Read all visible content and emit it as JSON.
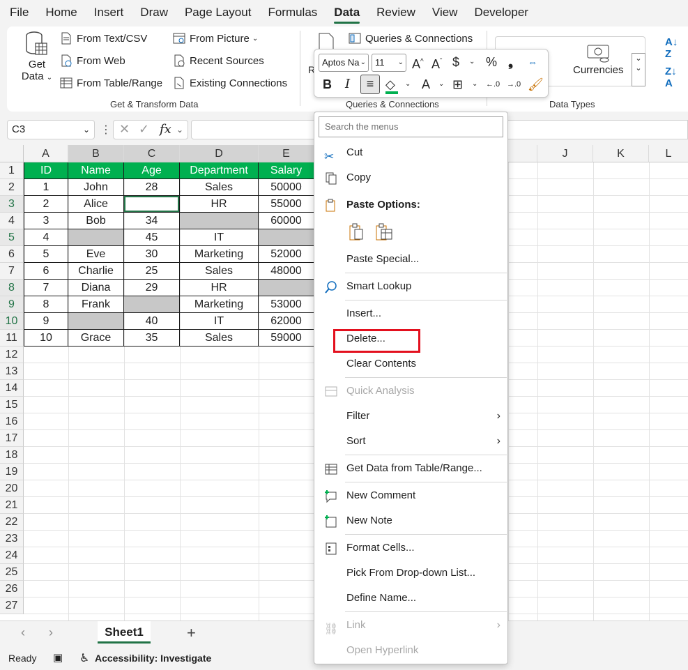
{
  "tabs": [
    "File",
    "Home",
    "Insert",
    "Draw",
    "Page Layout",
    "Formulas",
    "Data",
    "Review",
    "View",
    "Developer"
  ],
  "active_tab": "Data",
  "ribbon": {
    "get_data_label": "Get",
    "get_data_label2": "Data",
    "from_text_csv": "From Text/CSV",
    "from_web": "From Web",
    "from_table_range": "From Table/Range",
    "from_picture": "From Picture",
    "recent_sources": "Recent Sources",
    "existing_connections": "Existing Connections",
    "group_get_transform": "Get & Transform Data",
    "queries_connections": "Queries & Connections",
    "group_queries": "Queries & Connections",
    "refresh_partial": "R",
    "currencies": "Currencies",
    "group_data_types": "Data Types"
  },
  "mini_toolbar": {
    "font_name": "Aptos Na",
    "font_size": "11"
  },
  "formula_bar": {
    "name_box": "C3",
    "fx": "fx",
    "formula": ""
  },
  "columns": [
    "A",
    "B",
    "C",
    "D",
    "E",
    "J",
    "K",
    "L"
  ],
  "rows": [
    "1",
    "2",
    "3",
    "4",
    "5",
    "6",
    "7",
    "8",
    "9",
    "10",
    "11",
    "12",
    "13",
    "14",
    "15",
    "16",
    "17",
    "18",
    "19",
    "20",
    "21",
    "22",
    "23",
    "24",
    "25",
    "26",
    "27"
  ],
  "table": {
    "headers": [
      "ID",
      "Name",
      "Age",
      "Department",
      "Salary"
    ],
    "data": [
      [
        "1",
        "John",
        "28",
        "Sales",
        "50000"
      ],
      [
        "2",
        "Alice",
        "",
        "HR",
        "55000"
      ],
      [
        "3",
        "Bob",
        "34",
        "",
        "60000"
      ],
      [
        "4",
        "",
        "45",
        "IT",
        ""
      ],
      [
        "5",
        "Eve",
        "30",
        "Marketing",
        "52000"
      ],
      [
        "6",
        "Charlie",
        "25",
        "Sales",
        "48000"
      ],
      [
        "7",
        "Diana",
        "29",
        "HR",
        ""
      ],
      [
        "8",
        "Frank",
        "",
        "Marketing",
        "53000"
      ],
      [
        "9",
        "",
        "40",
        "IT",
        "62000"
      ],
      [
        "10",
        "Grace",
        "35",
        "Sales",
        "59000"
      ]
    ]
  },
  "sheet_tab": "Sheet1",
  "status": {
    "ready": "Ready",
    "accessibility": "Accessibility: Investigate"
  },
  "context_menu": {
    "search_placeholder": "Search the menus",
    "cut": "Cut",
    "copy": "Copy",
    "paste_options": "Paste Options:",
    "paste_special": "Paste Special...",
    "smart_lookup": "Smart Lookup",
    "insert": "Insert...",
    "delete": "Delete...",
    "clear_contents": "Clear Contents",
    "quick_analysis": "Quick Analysis",
    "filter": "Filter",
    "sort": "Sort",
    "get_data_table": "Get Data from Table/Range...",
    "new_comment": "New Comment",
    "new_note": "New Note",
    "format_cells": "Format Cells...",
    "pick_list": "Pick From Drop-down List...",
    "define_name": "Define Name...",
    "link": "Link",
    "open_hyperlink": "Open Hyperlink"
  },
  "colors": {
    "header_green": "#00b050",
    "accent": "#217346",
    "highlight_red": "#e3101e"
  }
}
